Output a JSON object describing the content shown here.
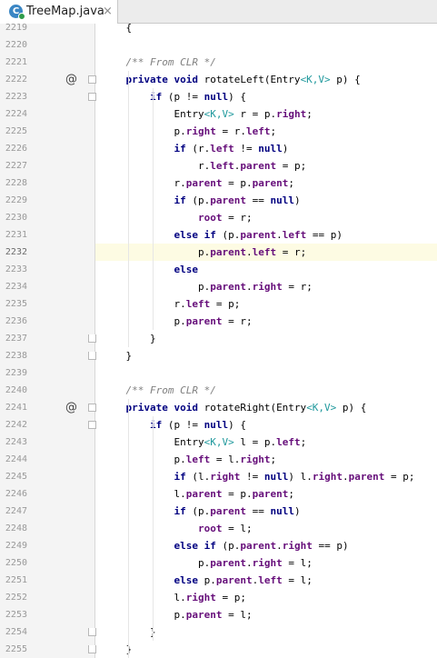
{
  "tab": {
    "icon_letter": "C",
    "label": "TreeMap.java",
    "close": "×"
  },
  "gutter": {
    "override_marker": "@"
  },
  "lines": [
    {
      "n": "2219",
      "t": [
        [
          "p",
          "    {"
        ]
      ]
    },
    {
      "n": "2220",
      "t": []
    },
    {
      "n": "2221",
      "t": [
        [
          "c",
          "    /** From CLR */"
        ]
      ]
    },
    {
      "n": "2222",
      "t": [
        [
          "p",
          "    "
        ],
        [
          "k",
          "private void "
        ],
        [
          "p",
          "rotateLeft(Entry"
        ],
        [
          "g",
          "<K,V>"
        ],
        [
          "p",
          " p) {"
        ]
      ],
      "mark": "@"
    },
    {
      "n": "2223",
      "t": [
        [
          "p",
          "        "
        ],
        [
          "k",
          "if "
        ],
        [
          "p",
          "(p != "
        ],
        [
          "k",
          "null"
        ],
        [
          "p",
          ") {"
        ]
      ]
    },
    {
      "n": "2224",
      "t": [
        [
          "p",
          "            Entry"
        ],
        [
          "g",
          "<K,V>"
        ],
        [
          "p",
          " r = p."
        ],
        [
          "f",
          "right"
        ],
        [
          "p",
          ";"
        ]
      ]
    },
    {
      "n": "2225",
      "t": [
        [
          "p",
          "            p."
        ],
        [
          "f",
          "right"
        ],
        [
          "p",
          " = r."
        ],
        [
          "f",
          "left"
        ],
        [
          "p",
          ";"
        ]
      ]
    },
    {
      "n": "2226",
      "t": [
        [
          "p",
          "            "
        ],
        [
          "k",
          "if "
        ],
        [
          "p",
          "(r."
        ],
        [
          "f",
          "left"
        ],
        [
          "p",
          " != "
        ],
        [
          "k",
          "null"
        ],
        [
          "p",
          ")"
        ]
      ]
    },
    {
      "n": "2227",
      "t": [
        [
          "p",
          "                r."
        ],
        [
          "f",
          "left"
        ],
        [
          "p",
          "."
        ],
        [
          "f",
          "parent"
        ],
        [
          "p",
          " = p;"
        ]
      ]
    },
    {
      "n": "2228",
      "t": [
        [
          "p",
          "            r."
        ],
        [
          "f",
          "parent"
        ],
        [
          "p",
          " = p."
        ],
        [
          "f",
          "parent"
        ],
        [
          "p",
          ";"
        ]
      ]
    },
    {
      "n": "2229",
      "t": [
        [
          "p",
          "            "
        ],
        [
          "k",
          "if "
        ],
        [
          "p",
          "(p."
        ],
        [
          "f",
          "parent"
        ],
        [
          "p",
          " == "
        ],
        [
          "k",
          "null"
        ],
        [
          "p",
          ")"
        ]
      ]
    },
    {
      "n": "2230",
      "t": [
        [
          "p",
          "                "
        ],
        [
          "f",
          "root"
        ],
        [
          "p",
          " = r;"
        ]
      ]
    },
    {
      "n": "2231",
      "t": [
        [
          "p",
          "            "
        ],
        [
          "k",
          "else if "
        ],
        [
          "p",
          "(p."
        ],
        [
          "f",
          "parent"
        ],
        [
          "p",
          "."
        ],
        [
          "f",
          "left"
        ],
        [
          "p",
          " == p)"
        ]
      ]
    },
    {
      "n": "2232",
      "t": [
        [
          "p",
          "                p."
        ],
        [
          "f",
          "parent"
        ],
        [
          "p",
          "."
        ],
        [
          "f",
          "left"
        ],
        [
          "p",
          " = r;"
        ]
      ],
      "current": true
    },
    {
      "n": "2233",
      "t": [
        [
          "p",
          "            "
        ],
        [
          "k",
          "else"
        ]
      ]
    },
    {
      "n": "2234",
      "t": [
        [
          "p",
          "                p."
        ],
        [
          "f",
          "parent"
        ],
        [
          "p",
          "."
        ],
        [
          "f",
          "right"
        ],
        [
          "p",
          " = r;"
        ]
      ]
    },
    {
      "n": "2235",
      "t": [
        [
          "p",
          "            r."
        ],
        [
          "f",
          "left"
        ],
        [
          "p",
          " = p;"
        ]
      ]
    },
    {
      "n": "2236",
      "t": [
        [
          "p",
          "            p."
        ],
        [
          "f",
          "parent"
        ],
        [
          "p",
          " = r;"
        ]
      ]
    },
    {
      "n": "2237",
      "t": [
        [
          "p",
          "        }"
        ]
      ]
    },
    {
      "n": "2238",
      "t": [
        [
          "p",
          "    }"
        ]
      ]
    },
    {
      "n": "2239",
      "t": []
    },
    {
      "n": "2240",
      "t": [
        [
          "c",
          "    /** From CLR */"
        ]
      ]
    },
    {
      "n": "2241",
      "t": [
        [
          "p",
          "    "
        ],
        [
          "k",
          "private void "
        ],
        [
          "p",
          "rotateRight(Entry"
        ],
        [
          "g",
          "<K,V>"
        ],
        [
          "p",
          " p) {"
        ]
      ],
      "mark": "@"
    },
    {
      "n": "2242",
      "t": [
        [
          "p",
          "        "
        ],
        [
          "k",
          "if "
        ],
        [
          "p",
          "(p != "
        ],
        [
          "k",
          "null"
        ],
        [
          "p",
          ") {"
        ]
      ]
    },
    {
      "n": "2243",
      "t": [
        [
          "p",
          "            Entry"
        ],
        [
          "g",
          "<K,V>"
        ],
        [
          "p",
          " l = p."
        ],
        [
          "f",
          "left"
        ],
        [
          "p",
          ";"
        ]
      ]
    },
    {
      "n": "2244",
      "t": [
        [
          "p",
          "            p."
        ],
        [
          "f",
          "left"
        ],
        [
          "p",
          " = l."
        ],
        [
          "f",
          "right"
        ],
        [
          "p",
          ";"
        ]
      ]
    },
    {
      "n": "2245",
      "t": [
        [
          "p",
          "            "
        ],
        [
          "k",
          "if "
        ],
        [
          "p",
          "(l."
        ],
        [
          "f",
          "right"
        ],
        [
          "p",
          " != "
        ],
        [
          "k",
          "null"
        ],
        [
          "p",
          ") l."
        ],
        [
          "f",
          "right"
        ],
        [
          "p",
          "."
        ],
        [
          "f",
          "parent"
        ],
        [
          "p",
          " = p;"
        ]
      ]
    },
    {
      "n": "2246",
      "t": [
        [
          "p",
          "            l."
        ],
        [
          "f",
          "parent"
        ],
        [
          "p",
          " = p."
        ],
        [
          "f",
          "parent"
        ],
        [
          "p",
          ";"
        ]
      ]
    },
    {
      "n": "2247",
      "t": [
        [
          "p",
          "            "
        ],
        [
          "k",
          "if "
        ],
        [
          "p",
          "(p."
        ],
        [
          "f",
          "parent"
        ],
        [
          "p",
          " == "
        ],
        [
          "k",
          "null"
        ],
        [
          "p",
          ")"
        ]
      ]
    },
    {
      "n": "2248",
      "t": [
        [
          "p",
          "                "
        ],
        [
          "f",
          "root"
        ],
        [
          "p",
          " = l;"
        ]
      ]
    },
    {
      "n": "2249",
      "t": [
        [
          "p",
          "            "
        ],
        [
          "k",
          "else if "
        ],
        [
          "p",
          "(p."
        ],
        [
          "f",
          "parent"
        ],
        [
          "p",
          "."
        ],
        [
          "f",
          "right"
        ],
        [
          "p",
          " == p)"
        ]
      ]
    },
    {
      "n": "2250",
      "t": [
        [
          "p",
          "                p."
        ],
        [
          "f",
          "parent"
        ],
        [
          "p",
          "."
        ],
        [
          "f",
          "right"
        ],
        [
          "p",
          " = l;"
        ]
      ]
    },
    {
      "n": "2251",
      "t": [
        [
          "p",
          "            "
        ],
        [
          "k",
          "else "
        ],
        [
          "p",
          "p."
        ],
        [
          "f",
          "parent"
        ],
        [
          "p",
          "."
        ],
        [
          "f",
          "left"
        ],
        [
          "p",
          " = l;"
        ]
      ]
    },
    {
      "n": "2252",
      "t": [
        [
          "p",
          "            l."
        ],
        [
          "f",
          "right"
        ],
        [
          "p",
          " = p;"
        ]
      ]
    },
    {
      "n": "2253",
      "t": [
        [
          "p",
          "            p."
        ],
        [
          "f",
          "parent"
        ],
        [
          "p",
          " = l;"
        ]
      ]
    },
    {
      "n": "2254",
      "t": [
        [
          "p",
          "        }"
        ]
      ]
    },
    {
      "n": "2255",
      "t": [
        [
          "p",
          "    }"
        ]
      ]
    }
  ],
  "colors": {
    "keyword": "#000080",
    "field": "#660e7a",
    "comment": "#808080",
    "generic": "#20999d",
    "current_line": "#fdfbe3"
  }
}
